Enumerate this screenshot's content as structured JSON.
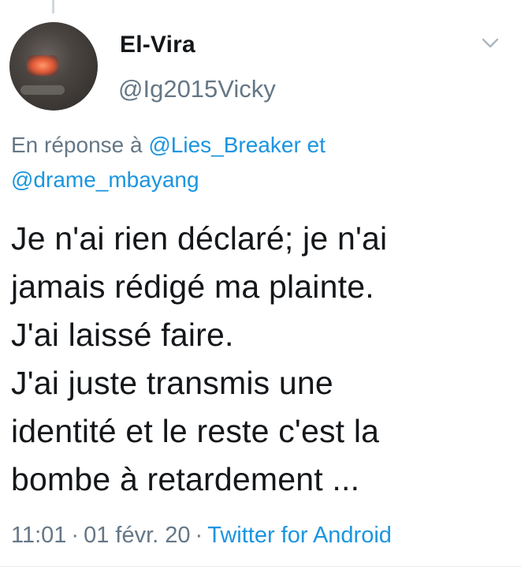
{
  "author": {
    "display_name": "El-Vira",
    "handle": "@Ig2015Vicky",
    "avatar_icon": "avatar-photo"
  },
  "menu": {
    "icon": "chevron-down-icon"
  },
  "reply_context": {
    "prefix": "En réponse à",
    "mention_1": "@Lies_Breaker",
    "joiner": "et",
    "mention_2": "@drame_mbayang"
  },
  "body": {
    "lines": [
      "Je n'ai rien déclaré; je n'ai",
      "jamais rédigé ma plainte.",
      "J'ai laissé faire.",
      "J'ai juste transmis une",
      "identité et le reste c'est la",
      "bombe à retardement ..."
    ]
  },
  "meta": {
    "time": "11:01",
    "separator": "·",
    "date": "01 févr. 20",
    "source": "Twitter for Android"
  },
  "colors": {
    "text": "#14171a",
    "secondary": "#657786",
    "link": "#1b95e0",
    "thread_line": "#cfd9de"
  }
}
